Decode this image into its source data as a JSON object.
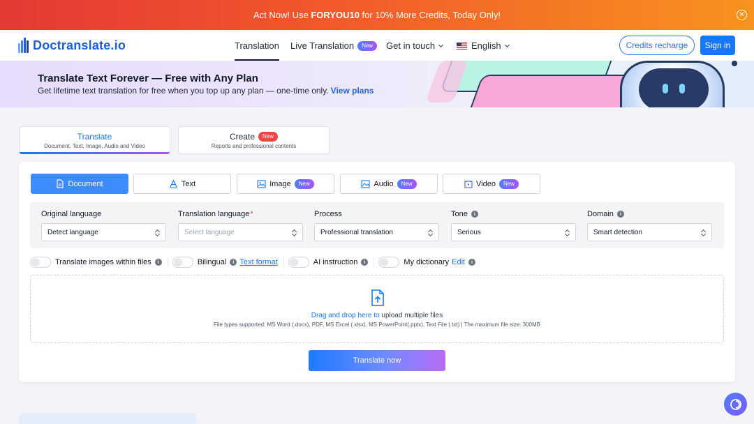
{
  "promo": {
    "prefix": "Act Now! Use ",
    "code": "FORYOU10",
    "suffix": " for 10% More Credits, Today Only!",
    "close_glyph": "✕"
  },
  "nav": {
    "logo": "Doctranslate.io",
    "links": {
      "translation": "Translation",
      "live_translation": "Live Translation",
      "get_in_touch": "Get in touch",
      "language": "English"
    },
    "new_badge": "New",
    "credits_button": "Credits recharge",
    "signin_button": "Sign in"
  },
  "banner": {
    "title": "Translate Text Forever — Free with Any Plan",
    "subtitle": "Get lifetime text translation for free when you top up any plan — one-time only.",
    "link": "View plans"
  },
  "modes": {
    "translate": {
      "title": "Translate",
      "subtitle": "Document, Text, Image, Audio and Video"
    },
    "create": {
      "title": "Create",
      "subtitle": "Reports and professional contents",
      "badge": "New"
    }
  },
  "types": {
    "document": "Document",
    "text": "Text",
    "image": "Image",
    "audio": "Audio",
    "video": "Video",
    "badge": "New"
  },
  "options": {
    "original_language": {
      "label": "Original language",
      "value": "Detect language"
    },
    "translation_language": {
      "label": "Translation language",
      "required": "*",
      "placeholder": "Select language"
    },
    "process": {
      "label": "Process",
      "value": "Professional translation"
    },
    "tone": {
      "label": "Tone",
      "value": "Serious"
    },
    "domain": {
      "label": "Domain",
      "value": "Smart detection"
    },
    "info_glyph": "i"
  },
  "toggles": {
    "translate_images": "Translate images within files",
    "bilingual": "Bilingual",
    "text_format": "Text format",
    "ai_instruction": "AI instruction",
    "my_dictionary": "My dictionary",
    "edit": "Edit"
  },
  "upload": {
    "drag_text": "Drag and drop here to",
    "rest_text": " upload multiple files",
    "file_types": "File types supported: MS Word (.docx), PDF, MS Excel (.xlsx), MS PowerPoint(.pptx), Text File (.txt) | The maximum file size: 300MB"
  },
  "translate_button": "Translate now",
  "colors": {
    "primary": "#1677ff",
    "promo_start": "#e53935",
    "promo_end": "#f7931e",
    "accent_purple": "#a855f7"
  }
}
